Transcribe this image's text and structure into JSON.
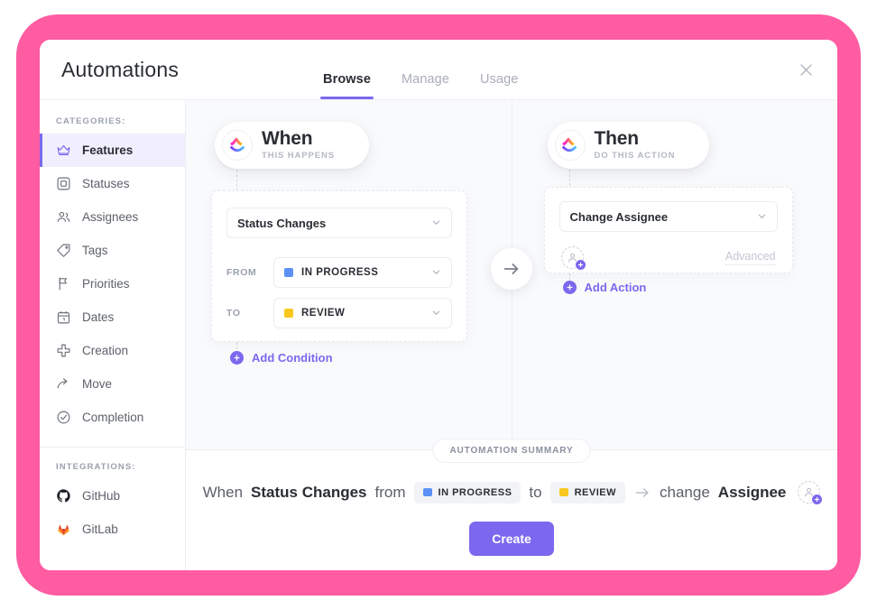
{
  "theme": {
    "frame_pink": "#ff5ca2",
    "accent_purple": "#7b68ee",
    "status_in_progress": "#5b91f5",
    "status_review": "#f9c81e"
  },
  "header": {
    "title": "Automations",
    "tabs": [
      {
        "label": "Browse",
        "active": true
      },
      {
        "label": "Manage",
        "active": false
      },
      {
        "label": "Usage",
        "active": false
      }
    ],
    "close_label": "Close"
  },
  "sidebar": {
    "categories_heading": "CATEGORIES:",
    "items": [
      {
        "label": "Features",
        "icon": "crown-icon",
        "active": true
      },
      {
        "label": "Statuses",
        "icon": "square-nested-icon",
        "active": false
      },
      {
        "label": "Assignees",
        "icon": "people-icon",
        "active": false
      },
      {
        "label": "Tags",
        "icon": "tag-icon",
        "active": false
      },
      {
        "label": "Priorities",
        "icon": "flag-icon",
        "active": false
      },
      {
        "label": "Dates",
        "icon": "calendar-icon",
        "active": false
      },
      {
        "label": "Creation",
        "icon": "plus-thick-icon",
        "active": false
      },
      {
        "label": "Move",
        "icon": "arrow-curve-icon",
        "active": false
      },
      {
        "label": "Completion",
        "icon": "check-circle-icon",
        "active": false
      }
    ],
    "integrations_heading": "INTEGRATIONS:",
    "integrations": [
      {
        "label": "GitHub",
        "icon": "github-icon"
      },
      {
        "label": "GitLab",
        "icon": "gitlab-icon"
      }
    ]
  },
  "when": {
    "pill_title": "When",
    "pill_subtitle": "THIS HAPPENS",
    "trigger": "Status Changes",
    "from_label": "FROM",
    "from_value": "IN PROGRESS",
    "from_color": "#5b91f5",
    "to_label": "TO",
    "to_value": "REVIEW",
    "to_color": "#f9c81e",
    "add_condition": "Add Condition"
  },
  "then": {
    "pill_title": "Then",
    "pill_subtitle": "DO THIS ACTION",
    "action": "Change Assignee",
    "advanced": "Advanced",
    "add_action": "Add Action"
  },
  "summary": {
    "chip": "AUTOMATION SUMMARY",
    "when_word": "When",
    "trigger": "Status Changes",
    "from_word": "from",
    "from_value": "IN PROGRESS",
    "to_word": "to",
    "to_value": "REVIEW",
    "change_word": "change",
    "target": "Assignee",
    "create_label": "Create"
  }
}
